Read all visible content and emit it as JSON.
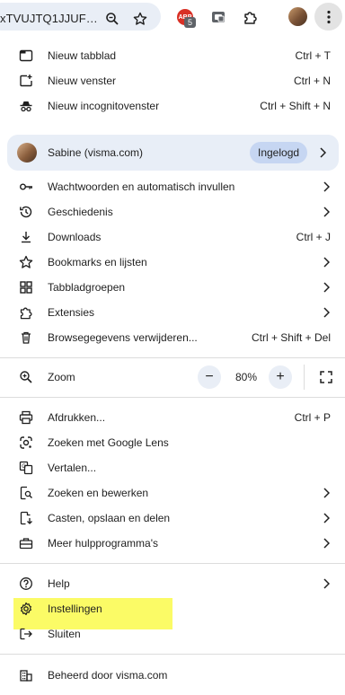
{
  "toolbar": {
    "address_text": "xTVUJTQ1JJUF…",
    "extension_badge": "5",
    "extension_abp_label": "ABP",
    "icons": [
      "zoom-icon",
      "bookmark-star-icon",
      "abp-extension-icon",
      "tab-extension-icon",
      "extensions-puzzle-icon",
      "profile-avatar",
      "more-menu-icon"
    ]
  },
  "menu": {
    "group1": [
      {
        "label": "Nieuw tabblad",
        "shortcut": "Ctrl + T",
        "icon": "new-tab-icon"
      },
      {
        "label": "Nieuw venster",
        "shortcut": "Ctrl + N",
        "icon": "new-window-icon"
      },
      {
        "label": "Nieuw incognitovenster",
        "shortcut": "Ctrl + Shift + N",
        "icon": "incognito-icon"
      }
    ],
    "profile": {
      "name": "Sabine (visma.com)",
      "status": "Ingelogd"
    },
    "group2": [
      {
        "label": "Wachtwoorden en automatisch invullen",
        "icon": "key-icon"
      },
      {
        "label": "Geschiedenis",
        "icon": "history-icon"
      },
      {
        "label": "Downloads",
        "shortcut": "Ctrl + J",
        "icon": "download-icon"
      },
      {
        "label": "Bookmarks en lijsten",
        "icon": "star-icon"
      },
      {
        "label": "Tabbladgroepen",
        "icon": "tab-groups-icon"
      },
      {
        "label": "Extensies",
        "icon": "puzzle-icon"
      },
      {
        "label": "Browsegegevens verwijderen...",
        "shortcut": "Ctrl + Shift + Del",
        "icon": "trash-icon"
      }
    ],
    "zoom": {
      "label": "Zoom",
      "value": "80%",
      "minus": "−",
      "plus": "+"
    },
    "group3": [
      {
        "label": "Afdrukken...",
        "shortcut": "Ctrl + P",
        "icon": "print-icon"
      },
      {
        "label": "Zoeken met Google Lens",
        "icon": "lens-icon"
      },
      {
        "label": "Vertalen...",
        "icon": "translate-icon"
      },
      {
        "label": "Zoeken en bewerken",
        "icon": "find-edit-icon"
      },
      {
        "label": "Casten, opslaan en delen",
        "icon": "cast-save-icon"
      },
      {
        "label": "Meer hulpprogramma's",
        "icon": "toolbox-icon"
      }
    ],
    "group4": [
      {
        "label": "Help",
        "icon": "help-icon"
      },
      {
        "label": "Instellingen",
        "icon": "settings-gear-icon"
      },
      {
        "label": "Sluiten",
        "icon": "exit-icon"
      }
    ],
    "managed": {
      "label": "Beheerd door visma.com",
      "icon": "building-icon"
    }
  },
  "colors": {
    "highlight": "#fafa4b",
    "profile_bg": "#e8eef7",
    "badge_bg": "#c6d6f2",
    "abp_red": "#d93025"
  }
}
